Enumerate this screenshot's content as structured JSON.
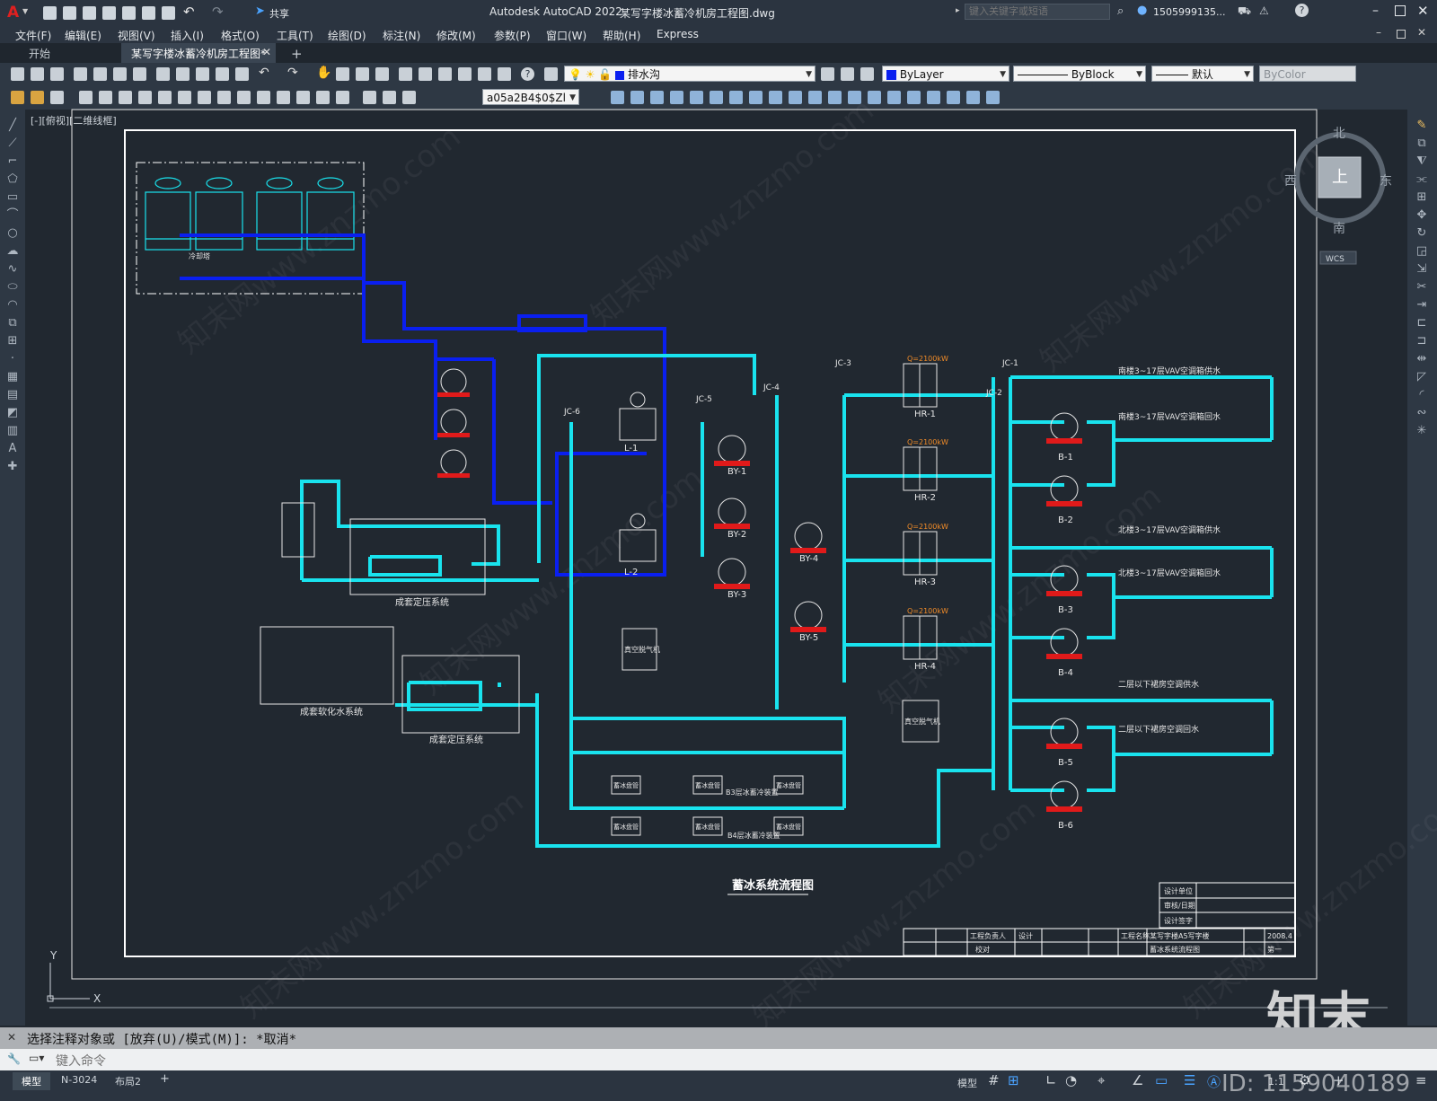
{
  "app": {
    "logo": "A",
    "product": "Autodesk AutoCAD 2022",
    "filename": "某写字楼冰蓄冷机房工程图.dwg",
    "search_placeholder": "键入关键字或短语",
    "user": "1505999135...",
    "share_label": "共享"
  },
  "menu": [
    "文件(F)",
    "编辑(E)",
    "视图(V)",
    "插入(I)",
    "格式(O)",
    "工具(T)",
    "绘图(D)",
    "标注(N)",
    "修改(M)",
    "参数(P)",
    "窗口(W)",
    "帮助(H)",
    "Express"
  ],
  "tabs": {
    "start": "开始",
    "drawing": "某写字楼冰蓄冷机房工程图*",
    "add": "+"
  },
  "toolbar": {
    "layer": "排水沟",
    "color": "ByLayer",
    "linetype": "ByBlock",
    "lineweight": "默认",
    "plotstyle": "ByColor",
    "block_name": "a05a2B4$0$Zl"
  },
  "viewport": {
    "label": "[-][俯视][二维线框]",
    "viewcube": {
      "north": "北",
      "south": "南",
      "east": "东",
      "west": "西",
      "top": "上",
      "wcs": "WCS"
    },
    "ucs_x": "X",
    "ucs_y": "Y"
  },
  "drawing": {
    "main_title": "蓄冰系统流程图",
    "labels": {
      "const_pressure_1": "成套定压系统",
      "const_pressure_2": "成套定压系统",
      "softening": "成套软化水系统",
      "deaerator_1": "真空脱气机",
      "deaerator_2": "真空脱气机",
      "chiller_1": "L-1",
      "chiller_2": "L-2",
      "pumps_by": [
        "BY-1",
        "BY-2",
        "BY-3",
        "BY-4",
        "BY-5"
      ],
      "heat_exchangers": [
        "HR-1",
        "HR-2",
        "HR-3",
        "HR-4"
      ],
      "pumps_b": [
        "B-1",
        "B-2",
        "B-3",
        "B-4",
        "B-5",
        "B-6"
      ],
      "hx_capacity": "Q=2100kW",
      "jc": [
        "JC-1",
        "JC-2",
        "JC-3",
        "JC-4",
        "JC-5",
        "JC-6"
      ],
      "supply_1": "南楼3~17层VAV空调箱供水",
      "return_1": "南楼3~17层VAV空调箱回水",
      "supply_2": "北楼3~17层VAV空调箱供水",
      "return_2": "北楼3~17层VAV空调箱回水",
      "supply_3": "二层以下裙房空调供水",
      "return_3": "二层以下裙房空调回水",
      "ice_tanks_1": "B3层冰蓄冷装置",
      "ice_tanks_2": "B4层冰蓄冷装置",
      "ice_tank": "蓄冰盘管",
      "cooling_tower": "冷却塔"
    },
    "title_block": {
      "design_unit": "设计单位",
      "review": "审核/日期",
      "signature": "设计签字",
      "engineer": "工程负责人",
      "check": "校对",
      "design": "设计",
      "project": "工程名称",
      "project_name": "某写字楼A5写字楼",
      "drawing_name": "蓄冰系统流程图",
      "date": "2008.4",
      "sheet": "第一"
    }
  },
  "command": {
    "history": "选择注释对象或 [放弃(U)/模式(M)]: *取消*",
    "placeholder": "键入命令"
  },
  "status": {
    "tabs": [
      "模型",
      "N-3024",
      "布局2",
      "+"
    ],
    "model": "模型",
    "scale": "1:1"
  },
  "watermark": {
    "brand": "知末",
    "id": "ID: 1159040189",
    "url": "知末网www.znzmo.com"
  },
  "colors": {
    "accent_cyan": "#19e3ee",
    "pipe_blue": "#0a1ff0",
    "pump_red": "#e01a1a",
    "canvas": "#212830"
  }
}
